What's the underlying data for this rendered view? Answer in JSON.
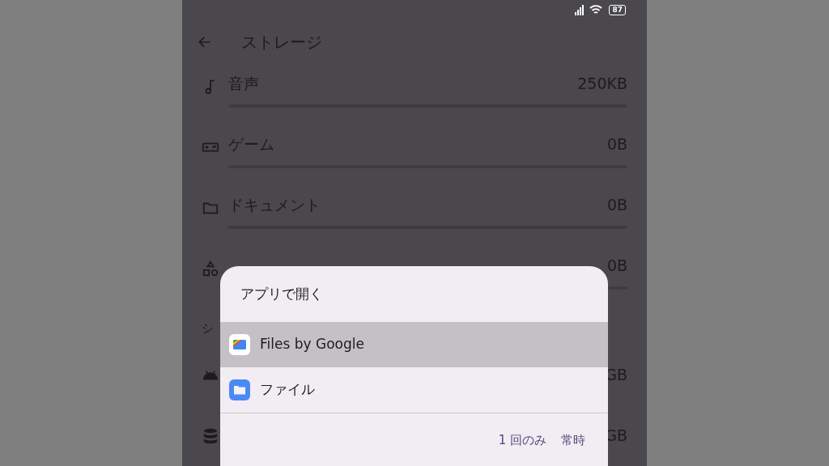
{
  "status_bar": {
    "battery": "87"
  },
  "app_bar": {
    "title": "ストレージ"
  },
  "rows": [
    {
      "kind": "music",
      "label": "音声",
      "value": "250KB"
    },
    {
      "kind": "game",
      "label": "ゲーム",
      "value": "0B"
    },
    {
      "kind": "folder",
      "label": "ドキュメント",
      "value": "0B"
    },
    {
      "kind": "shapes",
      "value": "0B"
    }
  ],
  "section": {
    "title": "シ"
  },
  "system_rows": [
    {
      "kind": "android",
      "value": "GB"
    },
    {
      "kind": "database",
      "value": "GB"
    }
  ],
  "dialog": {
    "title": "アプリで開く",
    "options": [
      {
        "kind": "files",
        "label": "Files by Google",
        "selected": true
      },
      {
        "kind": "folder",
        "label": "ファイル",
        "selected": false
      }
    ],
    "buttons": [
      "1 回のみ",
      "常時"
    ]
  }
}
